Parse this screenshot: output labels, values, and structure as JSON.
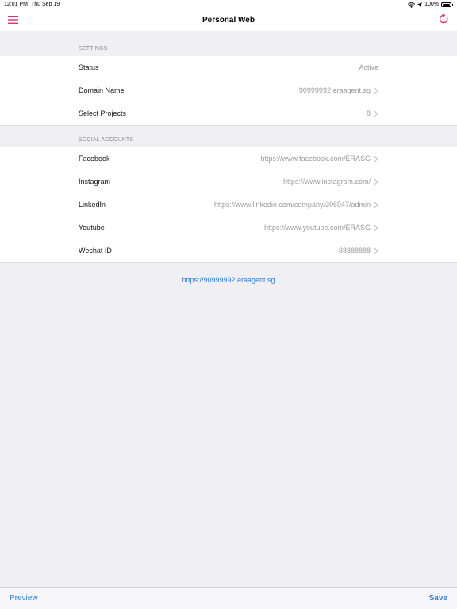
{
  "status_bar": {
    "time": "12:01 PM",
    "date": "Thu Sep 19",
    "battery": "100%",
    "battery_level": 1.0
  },
  "nav": {
    "title": "Personal Web",
    "left_icon": "hamburger-menu-icon",
    "right_icon": "refresh-icon",
    "accent_color": "#e0306a"
  },
  "settings": {
    "header": "SETTINGS",
    "rows": [
      {
        "label": "Status",
        "value": "Active"
      },
      {
        "label": "Domain Name",
        "value": "90999992.eraagent.sg"
      },
      {
        "label": "Select Projects",
        "value": "8"
      }
    ]
  },
  "social": {
    "header": "SOCIAL ACCOUNTS",
    "rows": [
      {
        "label": "Facebook",
        "value": "https://www.facebook.com/ERASG"
      },
      {
        "label": "Instagram",
        "value": "https://www.instagram.com/"
      },
      {
        "label": "LinkedIn",
        "value": "https://www.linkedin.com/company/306947/admin"
      },
      {
        "label": "Youtube",
        "value": "https://www.youtube.com/ERASG"
      },
      {
        "label": "Wechat ID",
        "value": "88888888"
      }
    ]
  },
  "domain_link": "https://90999992.eraagent.sg",
  "bottom_bar": {
    "preview_label": "Preview",
    "save_label": "Save"
  },
  "link_color": "#2d7fd3"
}
